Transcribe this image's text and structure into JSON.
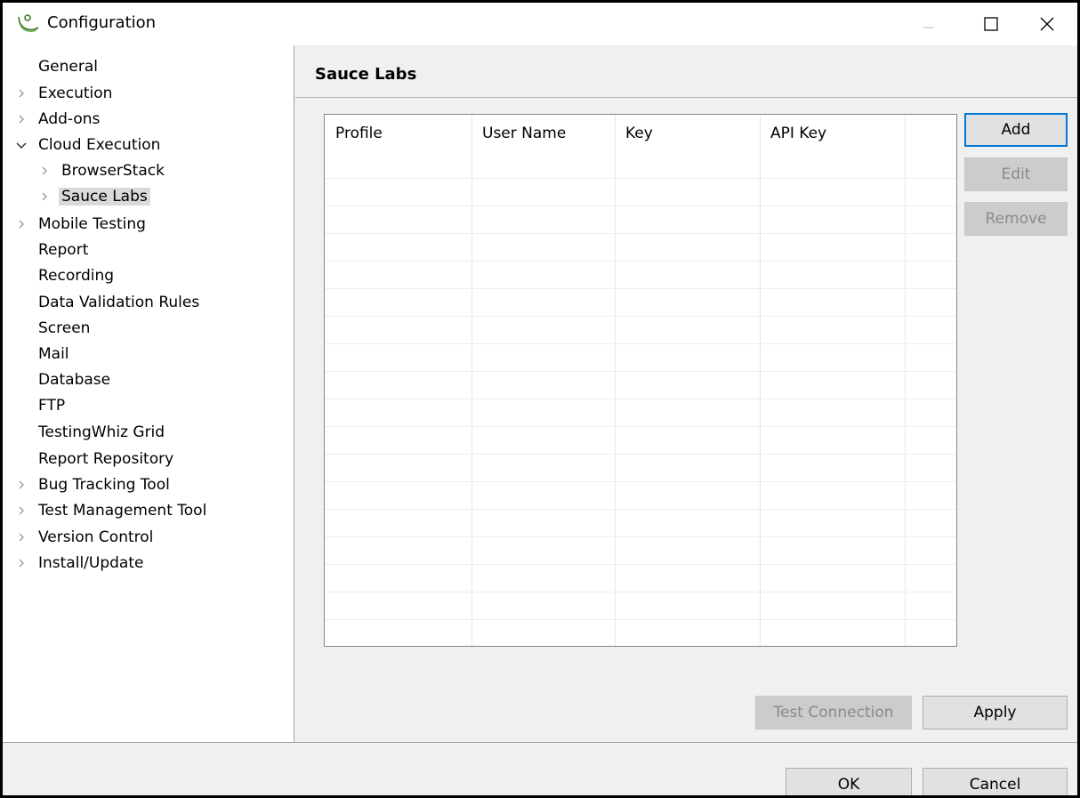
{
  "window": {
    "title": "Configuration"
  },
  "tree": {
    "items": [
      {
        "label": "General",
        "chevron": ""
      },
      {
        "label": "Execution",
        "chevron": "right"
      },
      {
        "label": "Add-ons",
        "chevron": "right"
      },
      {
        "label": "Cloud Execution",
        "chevron": "down"
      },
      {
        "label": "BrowserStack",
        "chevron": "right"
      },
      {
        "label": "Sauce Labs",
        "chevron": "right",
        "selected": true
      },
      {
        "label": "Mobile Testing",
        "chevron": "right"
      },
      {
        "label": "Report",
        "chevron": ""
      },
      {
        "label": "Recording",
        "chevron": ""
      },
      {
        "label": "Data Validation Rules",
        "chevron": ""
      },
      {
        "label": "Screen",
        "chevron": ""
      },
      {
        "label": "Mail",
        "chevron": ""
      },
      {
        "label": "Database",
        "chevron": ""
      },
      {
        "label": "FTP",
        "chevron": ""
      },
      {
        "label": "TestingWhiz Grid",
        "chevron": ""
      },
      {
        "label": "Report Repository",
        "chevron": ""
      },
      {
        "label": "Bug Tracking Tool",
        "chevron": "right"
      },
      {
        "label": "Test Management Tool",
        "chevron": "right"
      },
      {
        "label": "Version Control",
        "chevron": "right"
      },
      {
        "label": "Install/Update",
        "chevron": "right"
      }
    ]
  },
  "panel": {
    "title": "Sauce Labs",
    "table": {
      "columns": [
        "Profile",
        "User Name",
        "Key",
        "API Key"
      ],
      "rows": []
    },
    "buttons": {
      "add": "Add",
      "edit": "Edit",
      "remove": "Remove",
      "test_connection": "Test Connection",
      "apply": "Apply"
    }
  },
  "footer": {
    "ok": "OK",
    "cancel": "Cancel"
  },
  "colors": {
    "accent": "#0078d7",
    "selection": "#d9d9d9",
    "icon_green": "#3a7d2c"
  }
}
